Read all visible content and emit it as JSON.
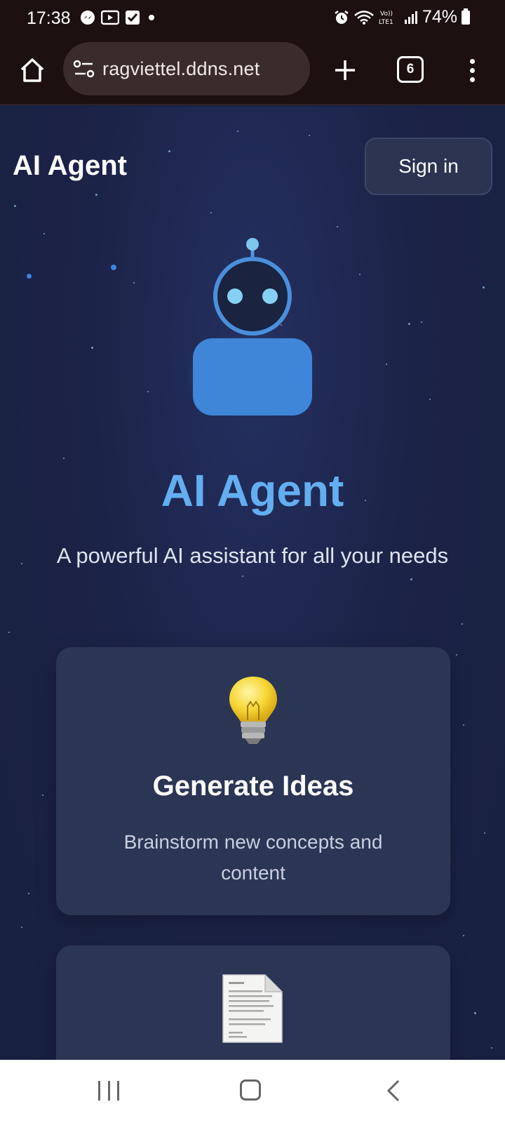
{
  "status_bar": {
    "time": "17:38",
    "notification_icons": [
      "messenger-icon",
      "video-app-icon",
      "checkbox-app-icon",
      "dot-icon"
    ],
    "battery": "74%",
    "system_icons": [
      "alarm-icon",
      "wifi-icon",
      "volte-icon",
      "signal-icon",
      "battery-icon"
    ],
    "network_label": "Vo)) LTE1"
  },
  "browser": {
    "url": "ragviettel.ddns.net",
    "tab_count": "6"
  },
  "header": {
    "brand": "AI Agent",
    "sign_in_label": "Sign in"
  },
  "hero": {
    "title": "AI Agent",
    "subtitle": "A powerful AI assistant for all your needs"
  },
  "features": [
    {
      "icon": "lightbulb-icon",
      "title": "Generate Ideas",
      "description": "Brainstorm new concepts and content"
    },
    {
      "icon": "document-icon"
    }
  ],
  "colors": {
    "background": "#1b2140",
    "accent": "#62aef0",
    "robot": "#3f86d8",
    "card": "#2b3554",
    "browser_chrome": "#1c1010"
  },
  "nav": {
    "buttons": [
      "recents-icon",
      "home-icon",
      "back-icon"
    ]
  }
}
